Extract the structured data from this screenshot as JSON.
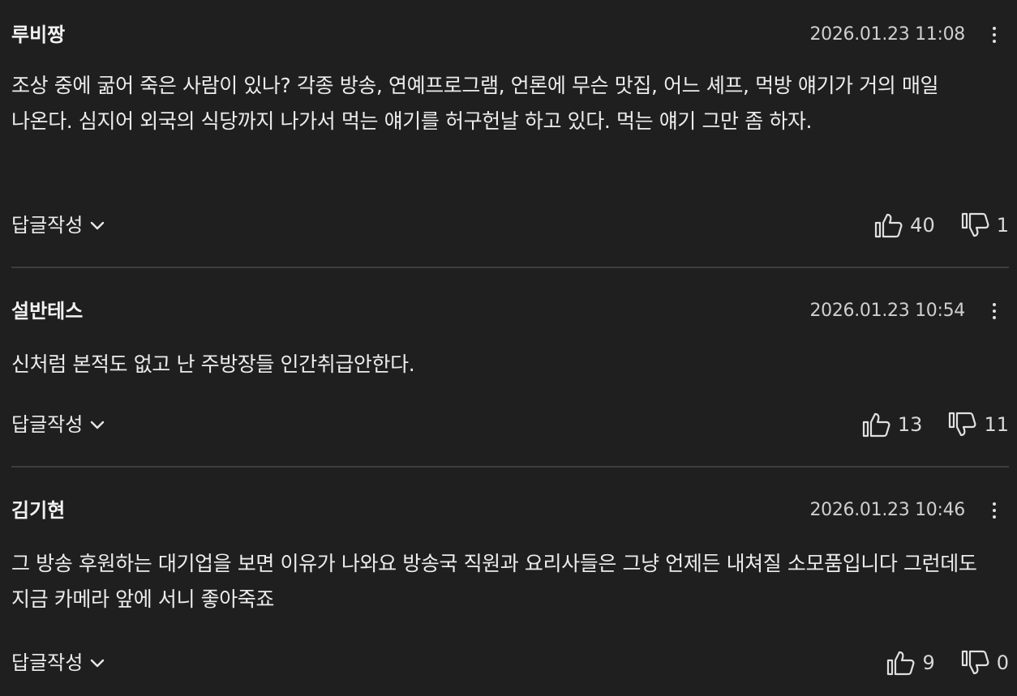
{
  "comments": [
    {
      "author": "루비짱",
      "timestamp": "2026.01.23 11:08",
      "body": "조상 중에 굶어 죽은 사람이 있나? 각종 방송, 연예프로그램, 언론에 무슨 맛집, 어느 셰프, 먹방 얘기가 거의 매일 나온다. 심지어 외국의 식당까지 나가서 먹는 얘기를 허구헌날 하고 있다. 먹는 얘기 그만 좀 하자.",
      "reply_label": "답글작성",
      "likes": "40",
      "dislikes": "1"
    },
    {
      "author": "설반테스",
      "timestamp": "2026.01.23 10:54",
      "body": "신처럼 본적도 없고 난 주방장들 인간취급안한다.",
      "reply_label": "답글작성",
      "likes": "13",
      "dislikes": "11"
    },
    {
      "author": "김기현",
      "timestamp": "2026.01.23 10:46",
      "body": "그 방송 후원하는 대기업을 보면 이유가 나와요 방송국 직원과 요리사들은 그냥 언제든 내쳐질 소모품입니다 그런데도 지금 카메라 앞에 서니 좋아죽죠",
      "reply_label": "답글작성",
      "likes": "9",
      "dislikes": "0"
    }
  ],
  "icons": {
    "more": "more-vertical-icon",
    "reply_toggle": "chevron-down-icon",
    "like": "thumbs-up-icon",
    "dislike": "thumbs-down-icon"
  },
  "colors": {
    "background": "#1f1f1f",
    "text": "#ececec",
    "muted": "#cfcfcf",
    "divider": "#3e3e3e"
  }
}
